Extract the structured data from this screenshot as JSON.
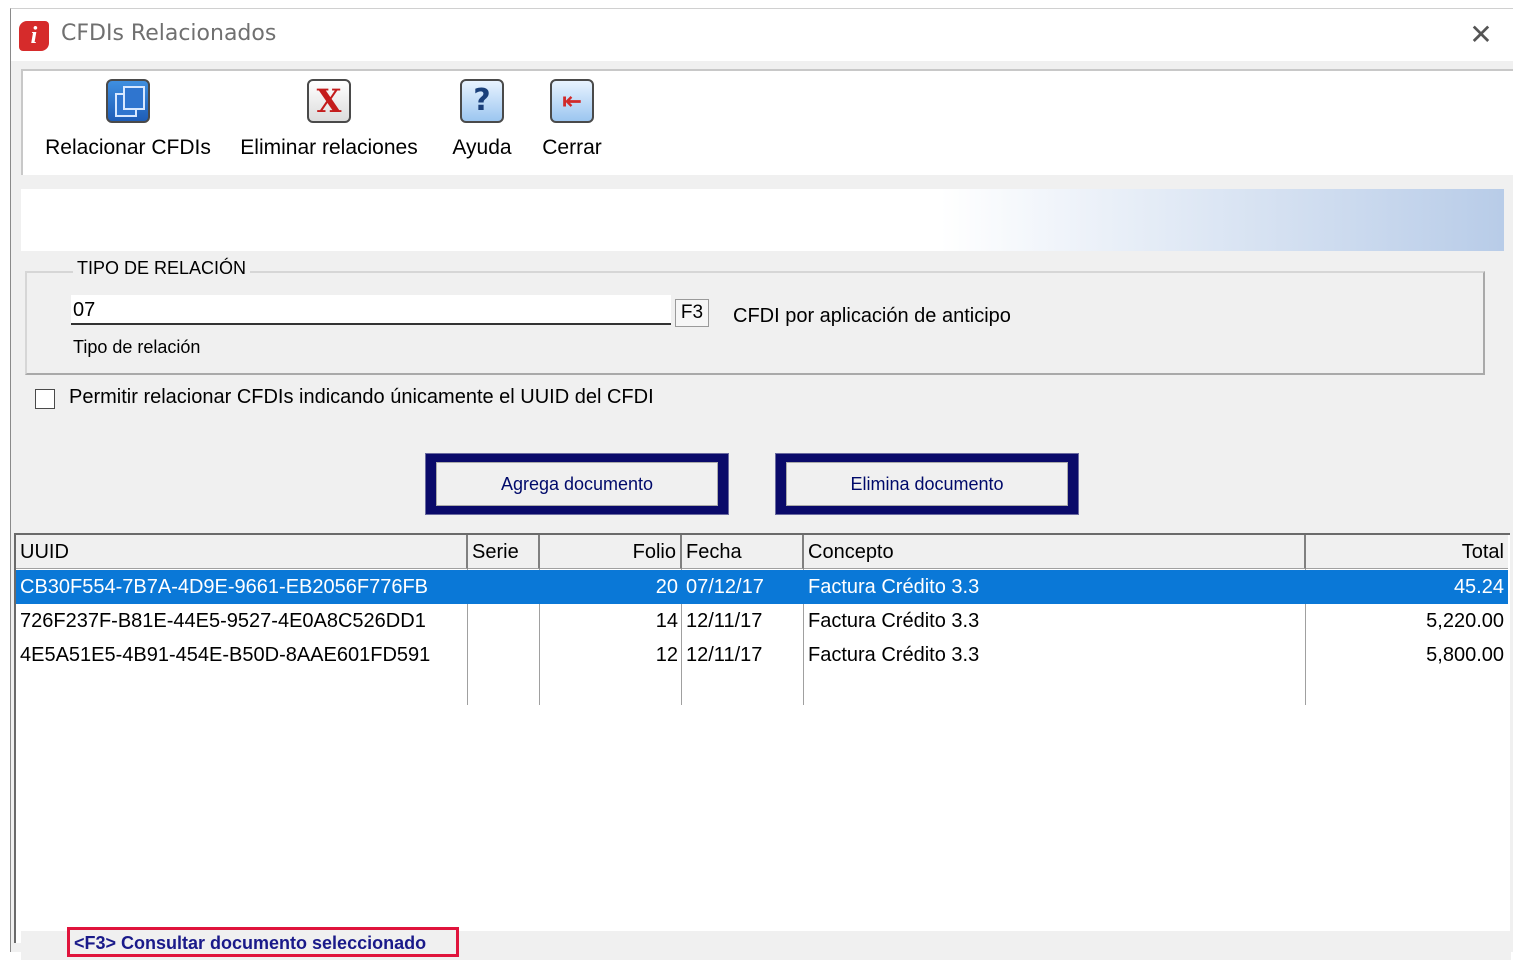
{
  "window": {
    "title": "CFDIs Relacionados",
    "close_glyph": "✕",
    "app_icon": "i"
  },
  "toolbar": {
    "items": [
      {
        "label": "Relacionar CFDIs",
        "icon": "stacked-documents-icon"
      },
      {
        "label": "Eliminar relaciones",
        "icon": "red-x-icon",
        "glyph": "X"
      },
      {
        "label": "Ayuda",
        "icon": "help-question-icon",
        "glyph": "?"
      },
      {
        "label": "Cerrar",
        "icon": "exit-door-icon",
        "glyph": "⇤"
      }
    ]
  },
  "relation": {
    "group_title": "TIPO DE RELACIÓN",
    "code": "07",
    "lookup_button": "F3",
    "description": "CFDI por aplicación de anticipo",
    "field_label": "Tipo de relación"
  },
  "options": {
    "uuid_only_label": "Permitir relacionar CFDIs indicando únicamente el UUID del CFDI",
    "uuid_only_checked": false
  },
  "buttons": {
    "add": "Agrega documento",
    "remove": "Elimina documento"
  },
  "table": {
    "columns": [
      "UUID",
      "Serie",
      "Folio",
      "Fecha",
      "Concepto",
      "Total"
    ],
    "rows": [
      {
        "uuid": "CB30F554-7B7A-4D9E-9661-EB2056F776FB",
        "serie": "",
        "folio": "20",
        "fecha": "07/12/17",
        "concepto": "Factura Crédito 3.3",
        "total": "45.24",
        "selected": true
      },
      {
        "uuid": "726F237F-B81E-44E5-9527-4E0A8C526DD1",
        "serie": "",
        "folio": "14",
        "fecha": "12/11/17",
        "concepto": "Factura Crédito 3.3",
        "total": "5,220.00",
        "selected": false
      },
      {
        "uuid": "4E5A51E5-4B91-454E-B50D-8AAE601FD591",
        "serie": "",
        "folio": "12",
        "fecha": "12/11/17",
        "concepto": "Factura Crédito 3.3",
        "total": "5,800.00",
        "selected": false
      }
    ]
  },
  "status": {
    "hint": "<F3> Consultar documento seleccionado"
  },
  "colors": {
    "selection": "#0a78d7",
    "button_frame": "#0a0a6a",
    "status_highlight": "#e0143c",
    "app_icon": "#d62b2b"
  }
}
